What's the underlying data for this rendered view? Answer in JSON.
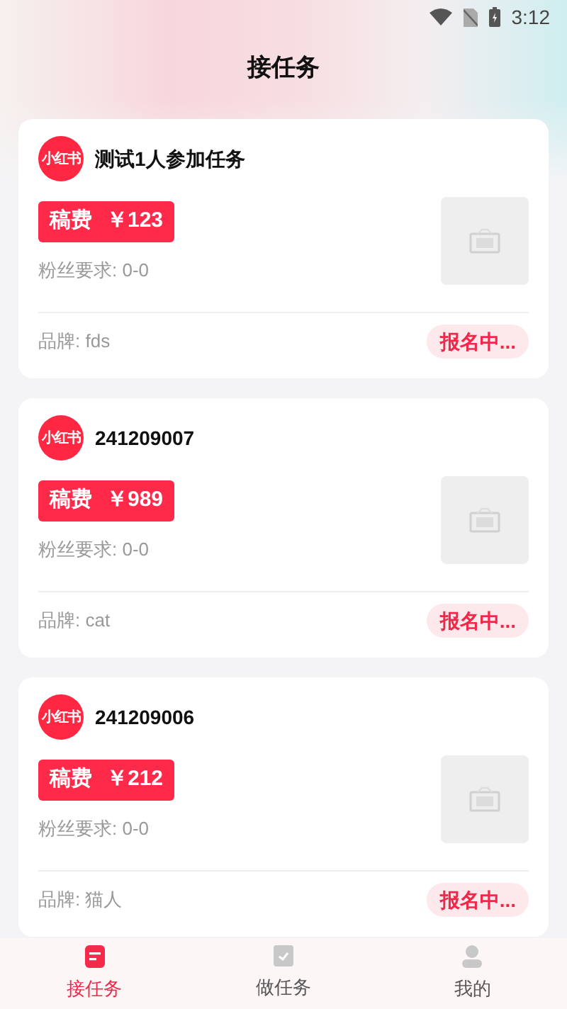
{
  "status_bar": {
    "time": "3:12"
  },
  "header": {
    "title": "接任务"
  },
  "tasks": [
    {
      "platform_logo": "小红书",
      "title": "测试1人参加任务",
      "fee_label": "稿费",
      "fee": "￥123",
      "fans_requirement": "粉丝要求: 0-0",
      "brand": "品牌: fds",
      "status": "报名中..."
    },
    {
      "platform_logo": "小红书",
      "title": "241209007",
      "fee_label": "稿费",
      "fee": "￥989",
      "fans_requirement": "粉丝要求: 0-0",
      "brand": "品牌: cat",
      "status": "报名中..."
    },
    {
      "platform_logo": "小红书",
      "title": "241209006",
      "fee_label": "稿费",
      "fee": "￥212",
      "fans_requirement": "粉丝要求: 0-0",
      "brand": "品牌: 猫人",
      "status": "报名中..."
    }
  ],
  "tab_bar": [
    {
      "kind": "list",
      "label": "接任务",
      "selected": true
    },
    {
      "kind": "check",
      "label": "做任务",
      "selected": false
    },
    {
      "kind": "person",
      "label": "我的",
      "selected": false
    }
  ]
}
